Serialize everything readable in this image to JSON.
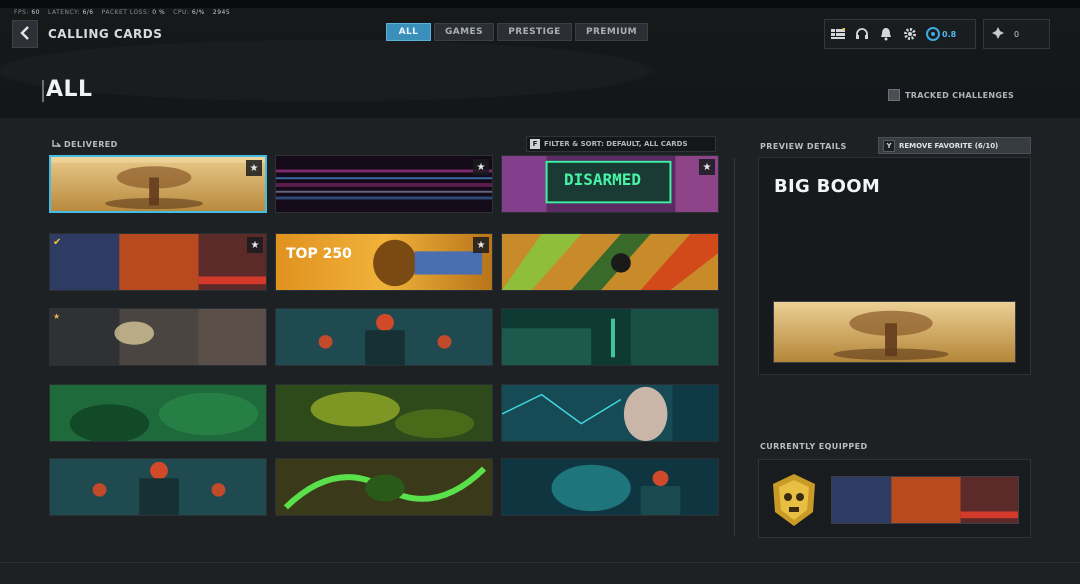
{
  "stats": [
    {
      "label": "FPS:",
      "value": "60"
    },
    {
      "label": "LATENCY:",
      "value": "6/6"
    },
    {
      "label": "PACKET LOSS:",
      "value": "0 %"
    },
    {
      "label": "CPU:",
      "value": "6/%"
    },
    {
      "label": "",
      "value": "2945"
    }
  ],
  "header": {
    "back_icon": "chevron-left-icon",
    "title": "CALLING CARDS"
  },
  "tabs": [
    "ALL",
    "GAMES",
    "PRESTIGE",
    "PREMIUM"
  ],
  "active_tab": "ALL",
  "top_icons": [
    "menu-grid-icon",
    "headset-icon",
    "bell-icon",
    "gear-icon"
  ],
  "level": {
    "value": "0.8"
  },
  "currency": {
    "icon": "cod-points-icon",
    "value": "0"
  },
  "page_title": "ALL",
  "tracked_challenges_label": "TRACKED CHALLENGES",
  "delivered_label": "DELIVERED",
  "filter_sort": {
    "key": "F",
    "label": "FILTER & SORT: DEFAULT, ALL CARDS"
  },
  "cards": [
    {
      "name": "big-boom",
      "selected": true,
      "favorite": true,
      "equipped": false,
      "text": ""
    },
    {
      "name": "glitch",
      "selected": false,
      "favorite": true,
      "equipped": false,
      "text": ""
    },
    {
      "name": "disarmed",
      "selected": false,
      "favorite": true,
      "equipped": false,
      "text": "DISARMED"
    },
    {
      "name": "squad-art",
      "selected": false,
      "favorite": true,
      "equipped": true,
      "text": ""
    },
    {
      "name": "top-250",
      "selected": false,
      "favorite": true,
      "equipped": false,
      "text": "TOP 250"
    },
    {
      "name": "camo-chaos",
      "selected": false,
      "favorite": false,
      "equipped": false,
      "text": ""
    },
    {
      "name": "firefight",
      "selected": false,
      "favorite": false,
      "equipped": false,
      "text": ""
    },
    {
      "name": "red-visor-squad",
      "selected": false,
      "favorite": false,
      "equipped": false,
      "text": ""
    },
    {
      "name": "night-ops",
      "selected": false,
      "favorite": false,
      "equipped": false,
      "text": ""
    },
    {
      "name": "green-recon",
      "selected": false,
      "favorite": false,
      "equipped": false,
      "text": ""
    },
    {
      "name": "toxic-haze",
      "selected": false,
      "favorite": false,
      "equipped": false,
      "text": ""
    },
    {
      "name": "cyber-face",
      "selected": false,
      "favorite": false,
      "equipped": false,
      "text": ""
    },
    {
      "name": "red-visor-squad-2",
      "selected": false,
      "favorite": false,
      "equipped": false,
      "text": ""
    },
    {
      "name": "green-fury",
      "selected": false,
      "favorite": false,
      "equipped": false,
      "text": ""
    },
    {
      "name": "cyber-skull",
      "selected": false,
      "favorite": false,
      "equipped": false,
      "text": ""
    }
  ],
  "preview": {
    "label": "PREVIEW DETAILS",
    "remove_key": "Y",
    "remove_label": "REMOVE FAVORITE (6/10)",
    "card_name": "BIG BOOM"
  },
  "equipped": {
    "label": "CURRENTLY EQUIPPED"
  },
  "colors": {
    "accent": "#3ea9e0",
    "selected_border": "#45bde2",
    "background": "#1e2124"
  }
}
